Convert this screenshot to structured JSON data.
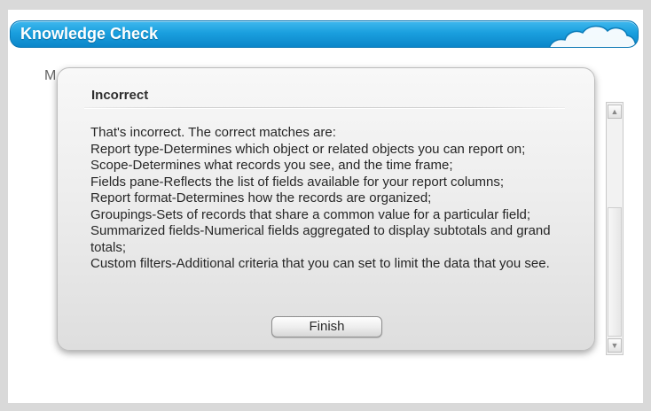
{
  "header": {
    "title": "Knowledge Check"
  },
  "background": {
    "partial_text": "M"
  },
  "dialog": {
    "title": "Incorrect",
    "lines": [
      "That's incorrect. The correct matches are:",
      "Report type-Determines which object or related objects you can report on;",
      "Scope-Determines what records you see, and the time frame;",
      "Fields pane-Reflects the list of fields available for your report columns;",
      "Report format-Determines how the records are organized;",
      "Groupings-Sets of records that share a common value for a particular field;",
      "Summarized fields-Numerical fields aggregated to display subtotals and grand totals;",
      "Custom filters-Additional criteria that you can set to limit the data that you see."
    ],
    "finish_label": "Finish"
  },
  "scrollbar": {
    "up_arrow": "▲",
    "down_arrow": "▼"
  },
  "colors": {
    "header_blue": "#1a9fde",
    "dialog_bg": "#ececec",
    "page_bg": "#ffffff",
    "outer_bg": "#d9d9d9"
  }
}
